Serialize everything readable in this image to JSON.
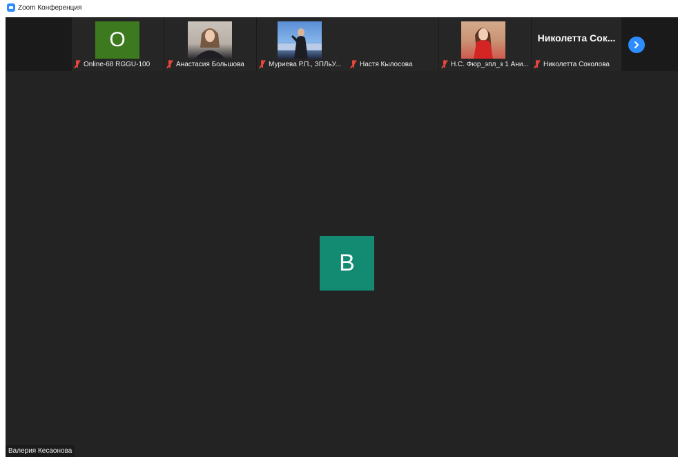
{
  "window": {
    "title": "Zoom Конференция"
  },
  "participants": [
    {
      "name": "Online-68 RGGU-100",
      "avatar_letter": "O",
      "avatar_color": "#3d7a1f",
      "muted": true
    },
    {
      "name": "Анастасия Большова",
      "avatar_type": "photo",
      "muted": true
    },
    {
      "name": "Муриева Р.П., ЗПЛьУ...",
      "avatar_type": "photo",
      "muted": true
    },
    {
      "name": "Настя Кылосова",
      "avatar_type": "none",
      "muted": true
    },
    {
      "name": "Н.С. Фюр_эпл_з 1 Ани...",
      "avatar_type": "photo",
      "muted": true
    },
    {
      "name": "Николетта Соколова",
      "display_name": "Николетта Сок...",
      "muted": true
    }
  ],
  "main_view": {
    "avatar_letter": "В",
    "avatar_color": "#138a72",
    "speaker_name": "Валерия Кесаонова"
  },
  "controls": {
    "next_page_icon": "chevron-right-icon"
  }
}
